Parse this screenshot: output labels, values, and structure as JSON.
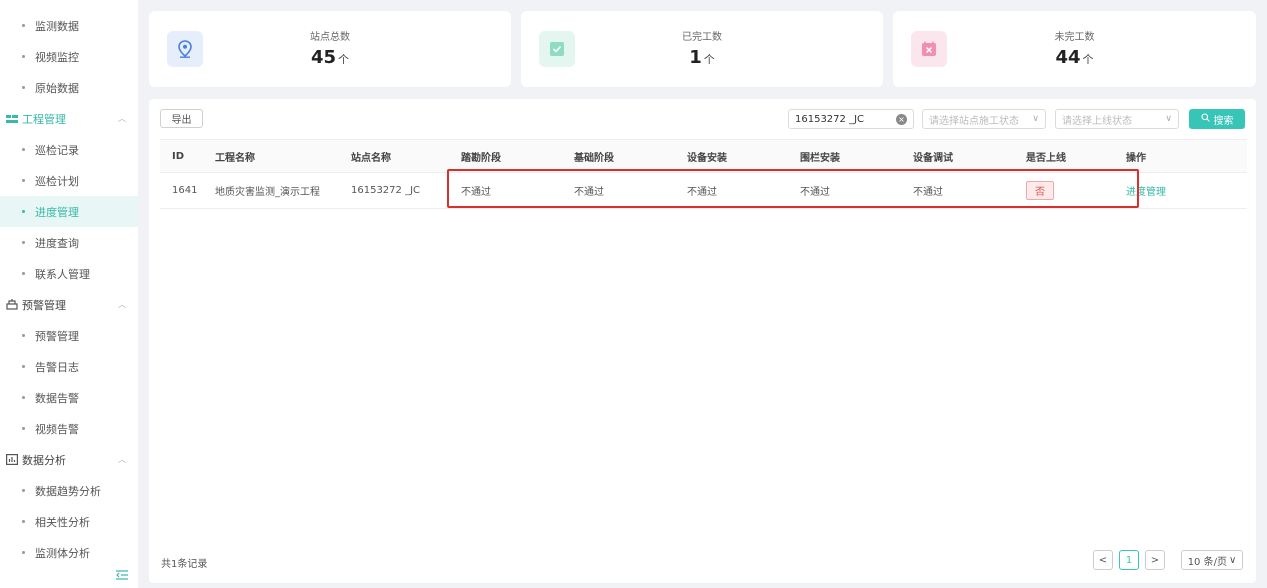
{
  "sidebar": {
    "items": [
      {
        "label": "监测数据"
      },
      {
        "label": "视频监控"
      },
      {
        "label": "原始数据"
      },
      {
        "label": "工程管理"
      },
      {
        "label": "巡检记录"
      },
      {
        "label": "巡检计划"
      },
      {
        "label": "进度管理"
      },
      {
        "label": "进度查询"
      },
      {
        "label": "联系人管理"
      },
      {
        "label": "预警管理"
      },
      {
        "label": "预警管理"
      },
      {
        "label": "告警日志"
      },
      {
        "label": "数据告警"
      },
      {
        "label": "视频告警"
      },
      {
        "label": "数据分析"
      },
      {
        "label": "数据趋势分析"
      },
      {
        "label": "相关性分析"
      },
      {
        "label": "监测体分析"
      }
    ],
    "collapse_icon": "collapse-icon"
  },
  "stats": [
    {
      "label": "站点总数",
      "value": "45",
      "unit": "个",
      "icon": "location-pin-icon",
      "color": "#4a7fe0"
    },
    {
      "label": "已完工数",
      "value": "1",
      "unit": "个",
      "icon": "check-square-icon",
      "color": "#37c5a0"
    },
    {
      "label": "未完工数",
      "value": "44",
      "unit": "个",
      "icon": "close-square-icon",
      "color": "#e0507a"
    }
  ],
  "toolbar": {
    "export_label": "导出",
    "search_value": "16153272 _JC",
    "status_placeholder": "请选择站点施工状态",
    "online_placeholder": "请选择上线状态",
    "search_label": "搜索"
  },
  "table": {
    "headers": [
      "ID",
      "工程名称",
      "站点名称",
      "踏勘阶段",
      "基础阶段",
      "设备安装",
      "围栏安装",
      "设备调试",
      "是否上线",
      "操作"
    ],
    "rows": [
      {
        "id": "1641",
        "project": "地质灾害监测_演示工程",
        "site": "16153272 _JC",
        "survey": "不通过",
        "foundation": "不通过",
        "install": "不通过",
        "fence": "不通过",
        "debug": "不通过",
        "online": "否",
        "action": "进度管理"
      }
    ]
  },
  "footer": {
    "total": "共1条记录",
    "prev": "<",
    "page": "1",
    "next": ">",
    "page_size": "10 条/页"
  }
}
